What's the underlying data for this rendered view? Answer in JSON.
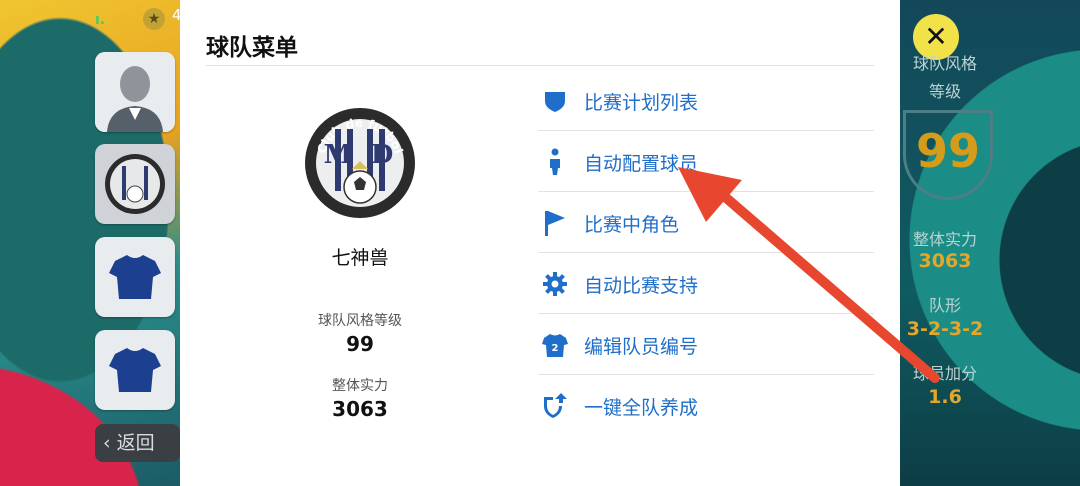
{
  "hud": {
    "bars": "ı.",
    "star": "★",
    "coins": "4"
  },
  "side": {
    "back_label": "返回",
    "back_icon": "chevron-left-icon"
  },
  "close": {
    "symbol": "✕"
  },
  "modal": {
    "title": "球队菜单",
    "team_name": "七神兽",
    "crest_text": "Club de futbol",
    "crest_letters": [
      "M",
      "D"
    ],
    "stats": [
      {
        "label": "球队风格等级",
        "value": "99"
      },
      {
        "label": "整体实力",
        "value": "3063"
      }
    ]
  },
  "menu": {
    "items": [
      {
        "label": "比赛计划列表",
        "icon": "shield-icon"
      },
      {
        "label": "自动配置球员",
        "icon": "person-icon"
      },
      {
        "label": "比赛中角色",
        "icon": "flag-icon"
      },
      {
        "label": "自动比赛支持",
        "icon": "gear-icon"
      },
      {
        "label": "编辑队员编号",
        "icon": "jersey-number-icon"
      },
      {
        "label": "一键全队养成",
        "icon": "shield-upgrade-icon"
      }
    ]
  },
  "right_panel": {
    "style_label": "球队风格",
    "level_label": "等级",
    "rating": "99",
    "overall_label": "整体实力",
    "overall_value": "3063",
    "formation_label": "队形",
    "formation_value": "3-2-3-2",
    "bonus_label": "球员加分",
    "bonus_value": "1.6"
  },
  "colors": {
    "accent": "#1f6ec9",
    "annotation_arrow": "#e8472f",
    "close_button": "#f2e24a"
  }
}
